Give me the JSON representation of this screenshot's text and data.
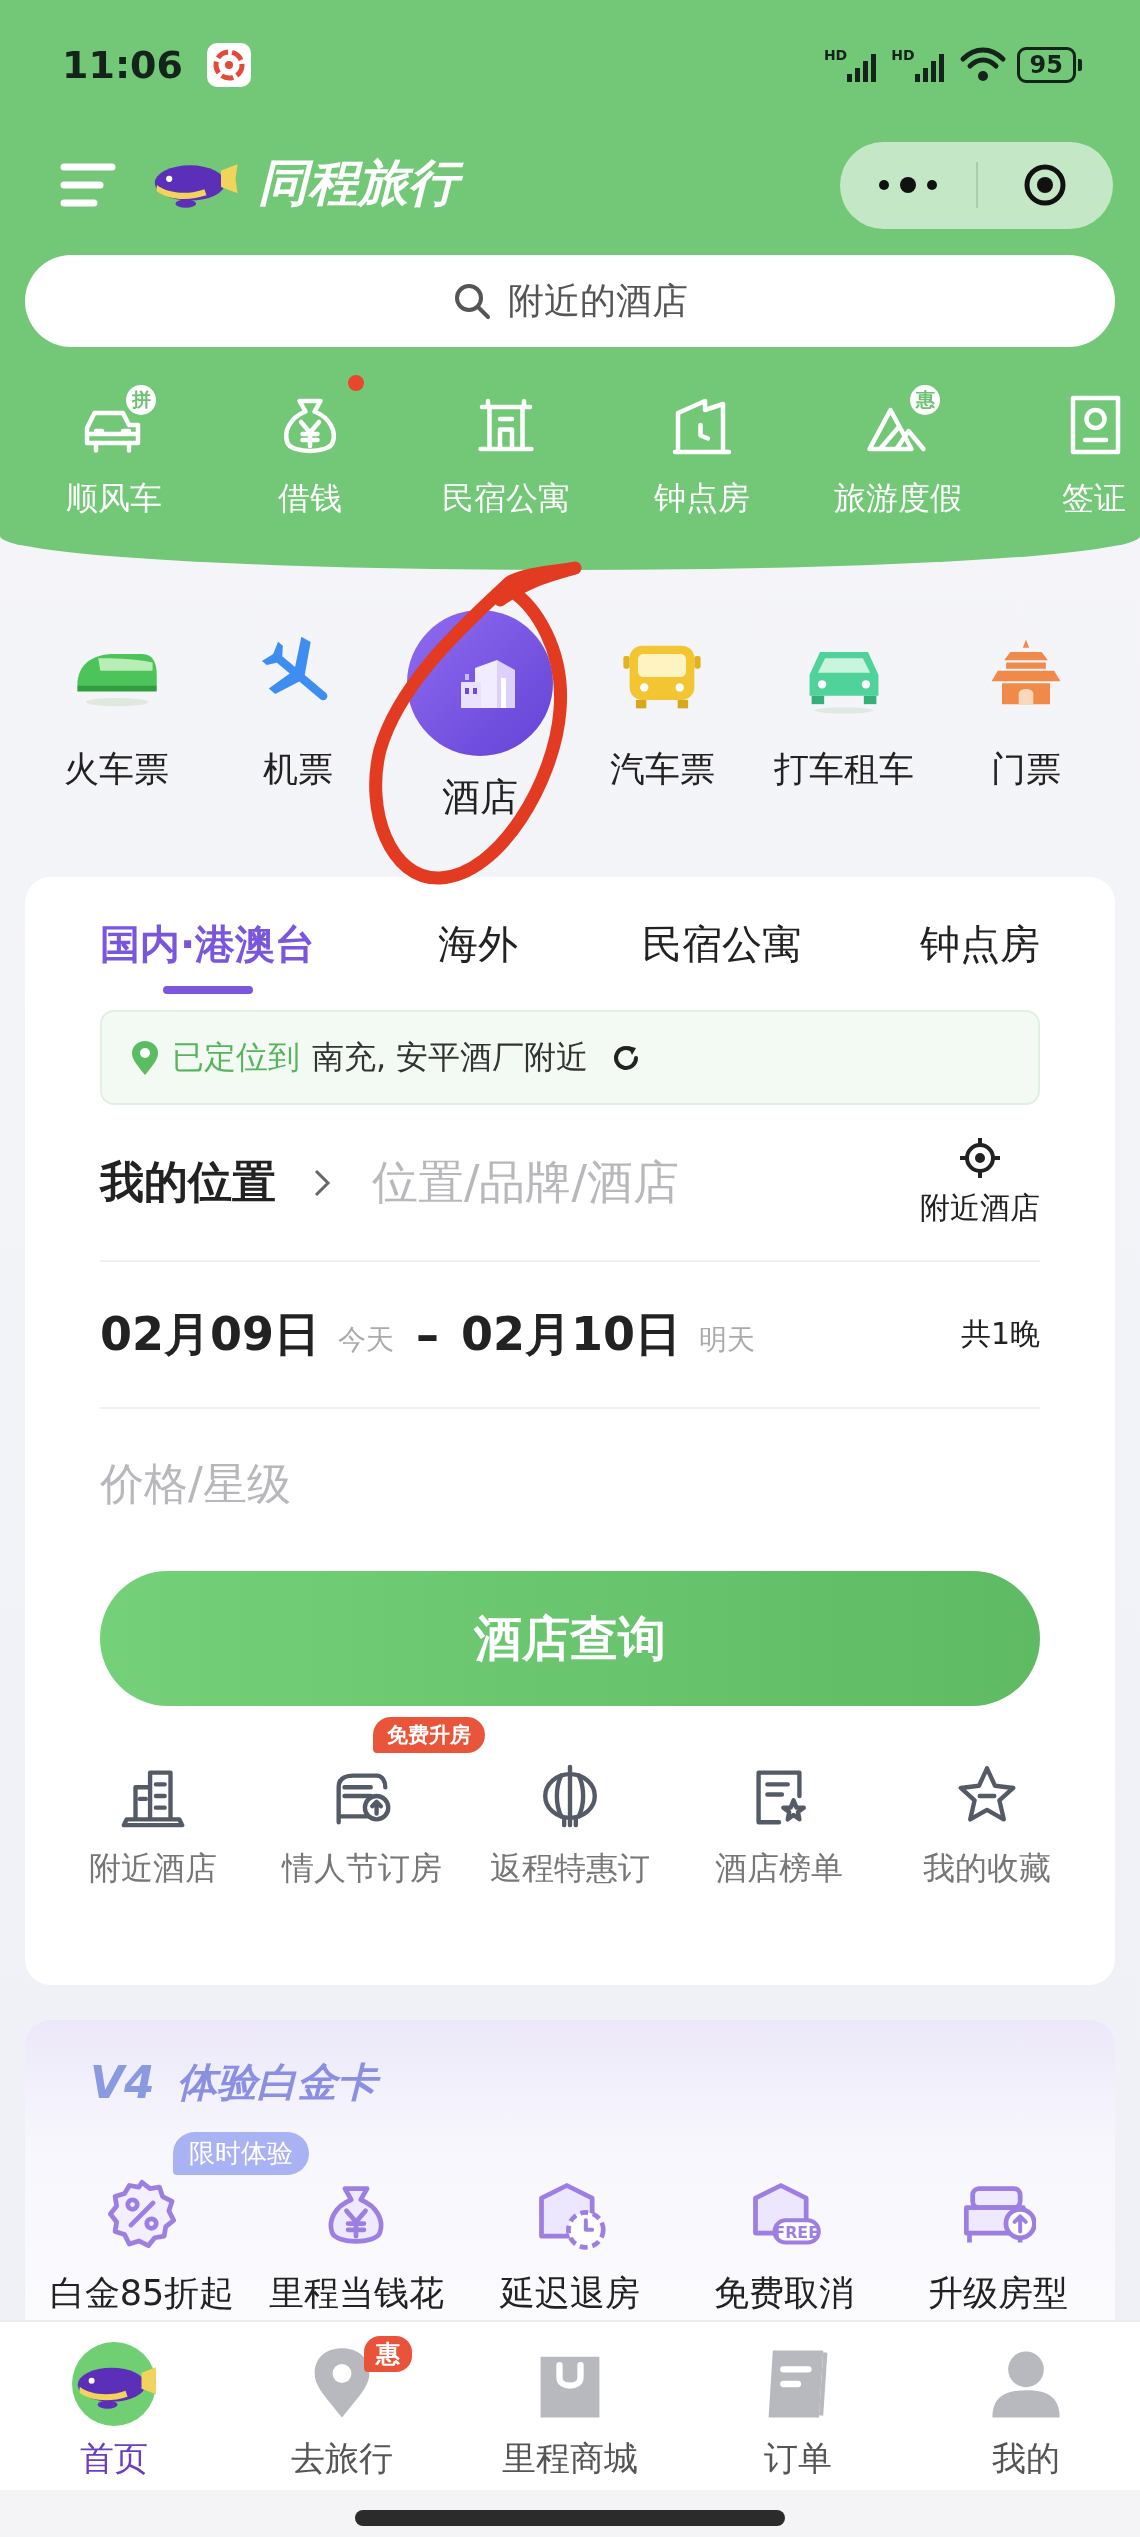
{
  "status_bar": {
    "time": "11:06",
    "signals": [
      {
        "label": "HD"
      },
      {
        "label": "HD"
      }
    ],
    "battery": "95"
  },
  "header": {
    "app_name": "同程旅行"
  },
  "search": {
    "placeholder": "附近的酒店"
  },
  "services": [
    {
      "label": "顺风车",
      "kind": "carpool",
      "badge": "拼",
      "dot": false
    },
    {
      "label": "借钱",
      "kind": "loan",
      "dot": true
    },
    {
      "label": "民宿公寓",
      "kind": "homestay",
      "dot": false
    },
    {
      "label": "钟点房",
      "kind": "hourly",
      "dot": false
    },
    {
      "label": "旅游度假",
      "kind": "vacation",
      "badge": "惠",
      "dot": false
    },
    {
      "label": "签证",
      "kind": "visa",
      "dot": false
    }
  ],
  "categories": [
    {
      "label": "火车票",
      "kind": "train",
      "selected": false
    },
    {
      "label": "机票",
      "kind": "flight",
      "selected": false
    },
    {
      "label": "酒店",
      "kind": "hotel",
      "selected": true
    },
    {
      "label": "汽车票",
      "kind": "bus",
      "selected": false
    },
    {
      "label": "打车租车",
      "kind": "taxi",
      "selected": false
    },
    {
      "label": "门票",
      "kind": "ticket",
      "selected": false
    }
  ],
  "hotel_card": {
    "tabs": [
      {
        "label": "国内·港澳台",
        "selected": true
      },
      {
        "label": "海外",
        "selected": false
      },
      {
        "label": "民宿公寓",
        "selected": false
      },
      {
        "label": "钟点房",
        "selected": false
      }
    ],
    "location": {
      "status": "已定位到",
      "place": "南充, 安平酒厂附近"
    },
    "destination": {
      "value": "我的位置",
      "placeholder": "位置/品牌/酒店",
      "nearby": "附近酒店"
    },
    "dates": {
      "checkin": "02月09日",
      "checkin_note": "今天",
      "separator": "–",
      "checkout": "02月10日",
      "checkout_note": "明天",
      "nights": "共1晚"
    },
    "price_star": {
      "placeholder": "价格/星级"
    },
    "search_button": "酒店查询",
    "quick_links": [
      {
        "label": "附近酒店",
        "kind": "nearby"
      },
      {
        "label": "情人节订房",
        "kind": "valentine",
        "badge": "免费升房"
      },
      {
        "label": "返程特惠订",
        "kind": "return"
      },
      {
        "label": "酒店榜单",
        "kind": "ranking"
      },
      {
        "label": "我的收藏",
        "kind": "favorite"
      }
    ]
  },
  "platinum": {
    "level": "V4",
    "title": "体验白金卡",
    "benefits": [
      {
        "label": "白金85折起",
        "kind": "discount",
        "badge": "限时体验"
      },
      {
        "label": "里程当钱花",
        "kind": "mileage"
      },
      {
        "label": "延迟退房",
        "kind": "late_checkout"
      },
      {
        "label": "免费取消",
        "kind": "free_cancel",
        "icon_text": "FREE"
      },
      {
        "label": "升级房型",
        "kind": "upgrade"
      }
    ]
  },
  "tab_bar": [
    {
      "label": "首页",
      "kind": "home",
      "selected": true
    },
    {
      "label": "去旅行",
      "kind": "travel",
      "selected": false,
      "badge": "惠"
    },
    {
      "label": "里程商城",
      "kind": "mall",
      "selected": false
    },
    {
      "label": "订单",
      "kind": "orders",
      "selected": false
    },
    {
      "label": "我的",
      "kind": "mine",
      "selected": false
    }
  ]
}
